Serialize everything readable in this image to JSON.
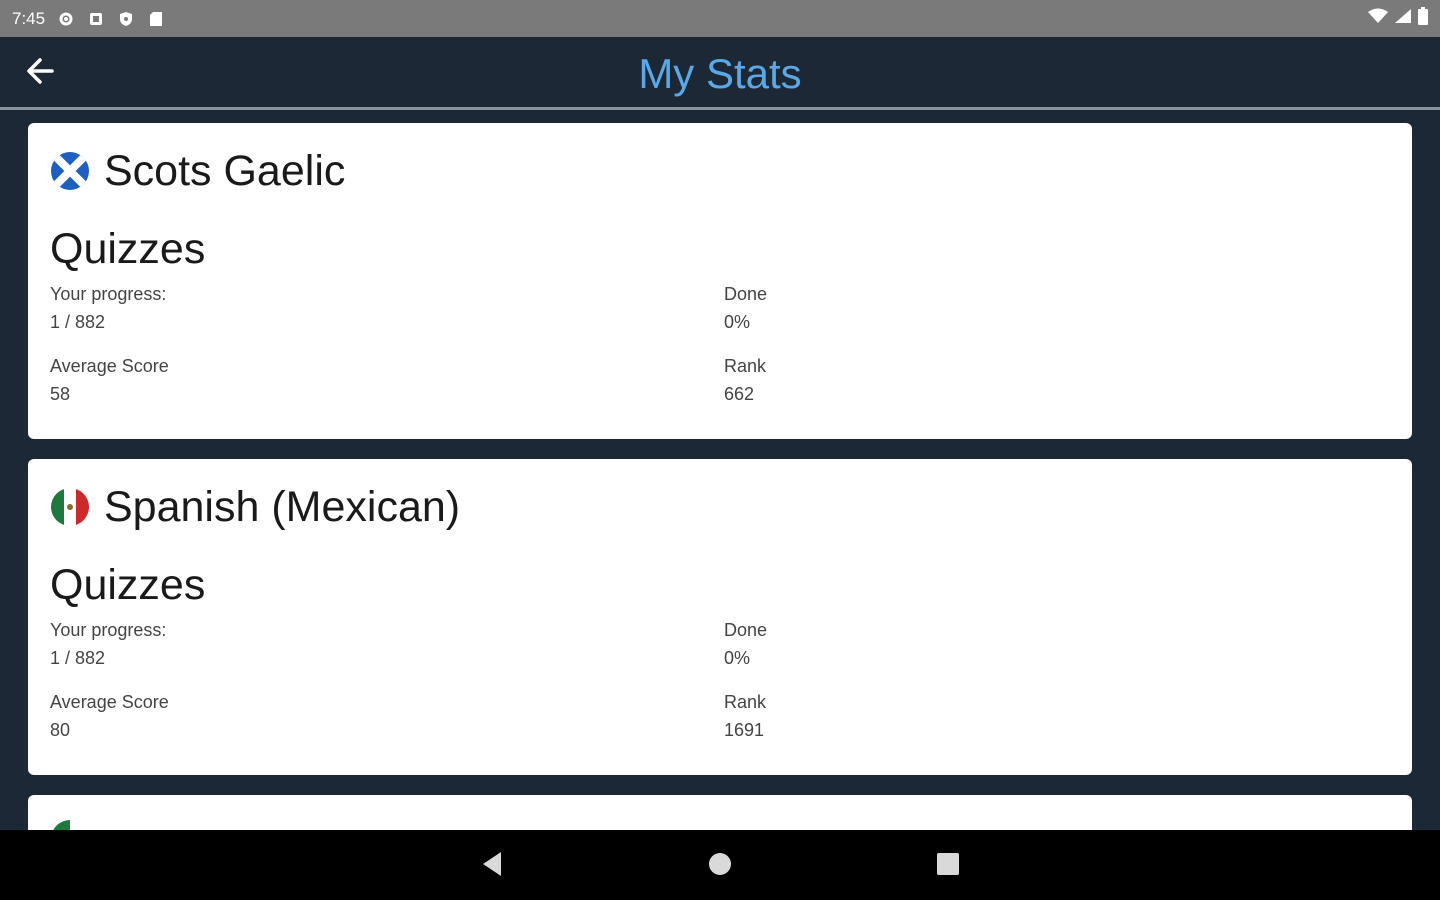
{
  "status_bar": {
    "time": "7:45",
    "icons": [
      "settings-icon",
      "notification-icon",
      "shield-icon",
      "sd-card-icon"
    ],
    "right_icons": [
      "wifi-icon",
      "signal-icon",
      "battery-icon"
    ]
  },
  "app_bar": {
    "title": "My Stats",
    "back_icon": "back-arrow-icon"
  },
  "cards": [
    {
      "flag": "scotland-flag",
      "language": "Scots Gaelic",
      "section": "Quizzes",
      "progress_label": "Your progress:",
      "progress_value": "1 / 882",
      "done_label": "Done",
      "done_value": "0%",
      "avg_label": "Average Score",
      "avg_value": "58",
      "rank_label": "Rank",
      "rank_value": "662"
    },
    {
      "flag": "mexico-flag",
      "language": "Spanish (Mexican)",
      "section": "Quizzes",
      "progress_label": "Your progress:",
      "progress_value": "1 / 882",
      "done_label": "Done",
      "done_value": "0%",
      "avg_label": "Average Score",
      "avg_value": "80",
      "rank_label": "Rank",
      "rank_value": "1691"
    }
  ],
  "colors": {
    "background": "#1d2836",
    "title": "#5aa8e6",
    "card": "#ffffff"
  },
  "nav_bar": {
    "icons": [
      "nav-back-icon",
      "nav-home-icon",
      "nav-recents-icon"
    ]
  }
}
